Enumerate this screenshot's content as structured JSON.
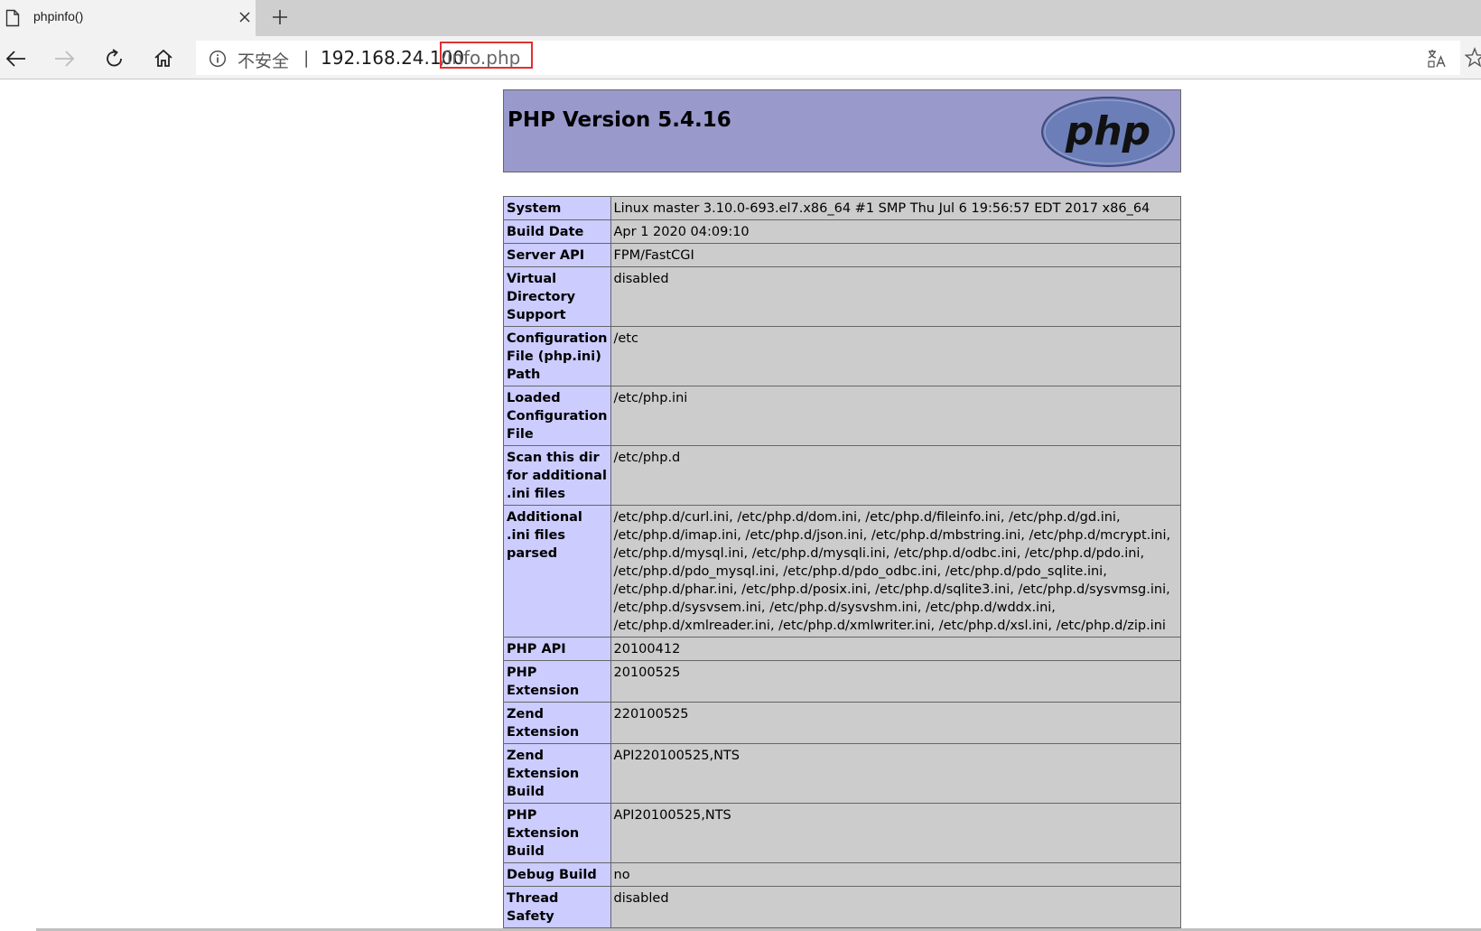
{
  "tab": {
    "title": "phpinfo()"
  },
  "address": {
    "security_label": "不安全",
    "separator": "|",
    "host": "192.168.24.100",
    "path": "/info.php"
  },
  "page": {
    "title": "PHP Version 5.4.16",
    "logo_text": "php",
    "rows": [
      {
        "key": "System",
        "value": "Linux master 3.10.0-693.el7.x86_64 #1 SMP Thu Jul 6 19:56:57 EDT 2017 x86_64"
      },
      {
        "key": "Build Date",
        "value": "Apr 1 2020 04:09:10"
      },
      {
        "key": "Server API",
        "value": "FPM/FastCGI"
      },
      {
        "key": "Virtual Directory Support",
        "value": "disabled"
      },
      {
        "key": "Configuration File (php.ini) Path",
        "value": "/etc"
      },
      {
        "key": "Loaded Configuration File",
        "value": "/etc/php.ini"
      },
      {
        "key": "Scan this dir for additional .ini files",
        "value": "/etc/php.d"
      },
      {
        "key": "Additional .ini files parsed",
        "value": "/etc/php.d/curl.ini, /etc/php.d/dom.ini, /etc/php.d/fileinfo.ini, /etc/php.d/gd.ini, /etc/php.d/imap.ini, /etc/php.d/json.ini, /etc/php.d/mbstring.ini, /etc/php.d/mcrypt.ini, /etc/php.d/mysql.ini, /etc/php.d/mysqli.ini, /etc/php.d/odbc.ini, /etc/php.d/pdo.ini, /etc/php.d/pdo_mysql.ini, /etc/php.d/pdo_odbc.ini, /etc/php.d/pdo_sqlite.ini, /etc/php.d/phar.ini, /etc/php.d/posix.ini, /etc/php.d/sqlite3.ini, /etc/php.d/sysvmsg.ini, /etc/php.d/sysvsem.ini, /etc/php.d/sysvshm.ini, /etc/php.d/wddx.ini, /etc/php.d/xmlreader.ini, /etc/php.d/xmlwriter.ini, /etc/php.d/xsl.ini, /etc/php.d/zip.ini"
      },
      {
        "key": "PHP API",
        "value": "20100412"
      },
      {
        "key": "PHP Extension",
        "value": "20100525"
      },
      {
        "key": "Zend Extension",
        "value": "220100525"
      },
      {
        "key": "Zend Extension Build",
        "value": "API220100525,NTS"
      },
      {
        "key": "PHP Extension Build",
        "value": "API20100525,NTS"
      },
      {
        "key": "Debug Build",
        "value": "no"
      },
      {
        "key": "Thread Safety",
        "value": "disabled"
      }
    ]
  },
  "colors": {
    "header_bg": "#9999cc",
    "key_cell_bg": "#ccccff",
    "value_cell_bg": "#cccccc",
    "url_highlight": "#e03030"
  },
  "icons": [
    "page-icon",
    "close-icon",
    "plus-icon",
    "back-arrow-icon",
    "forward-arrow-icon",
    "refresh-icon",
    "home-icon",
    "info-icon",
    "translate-icon",
    "star-icon"
  ]
}
